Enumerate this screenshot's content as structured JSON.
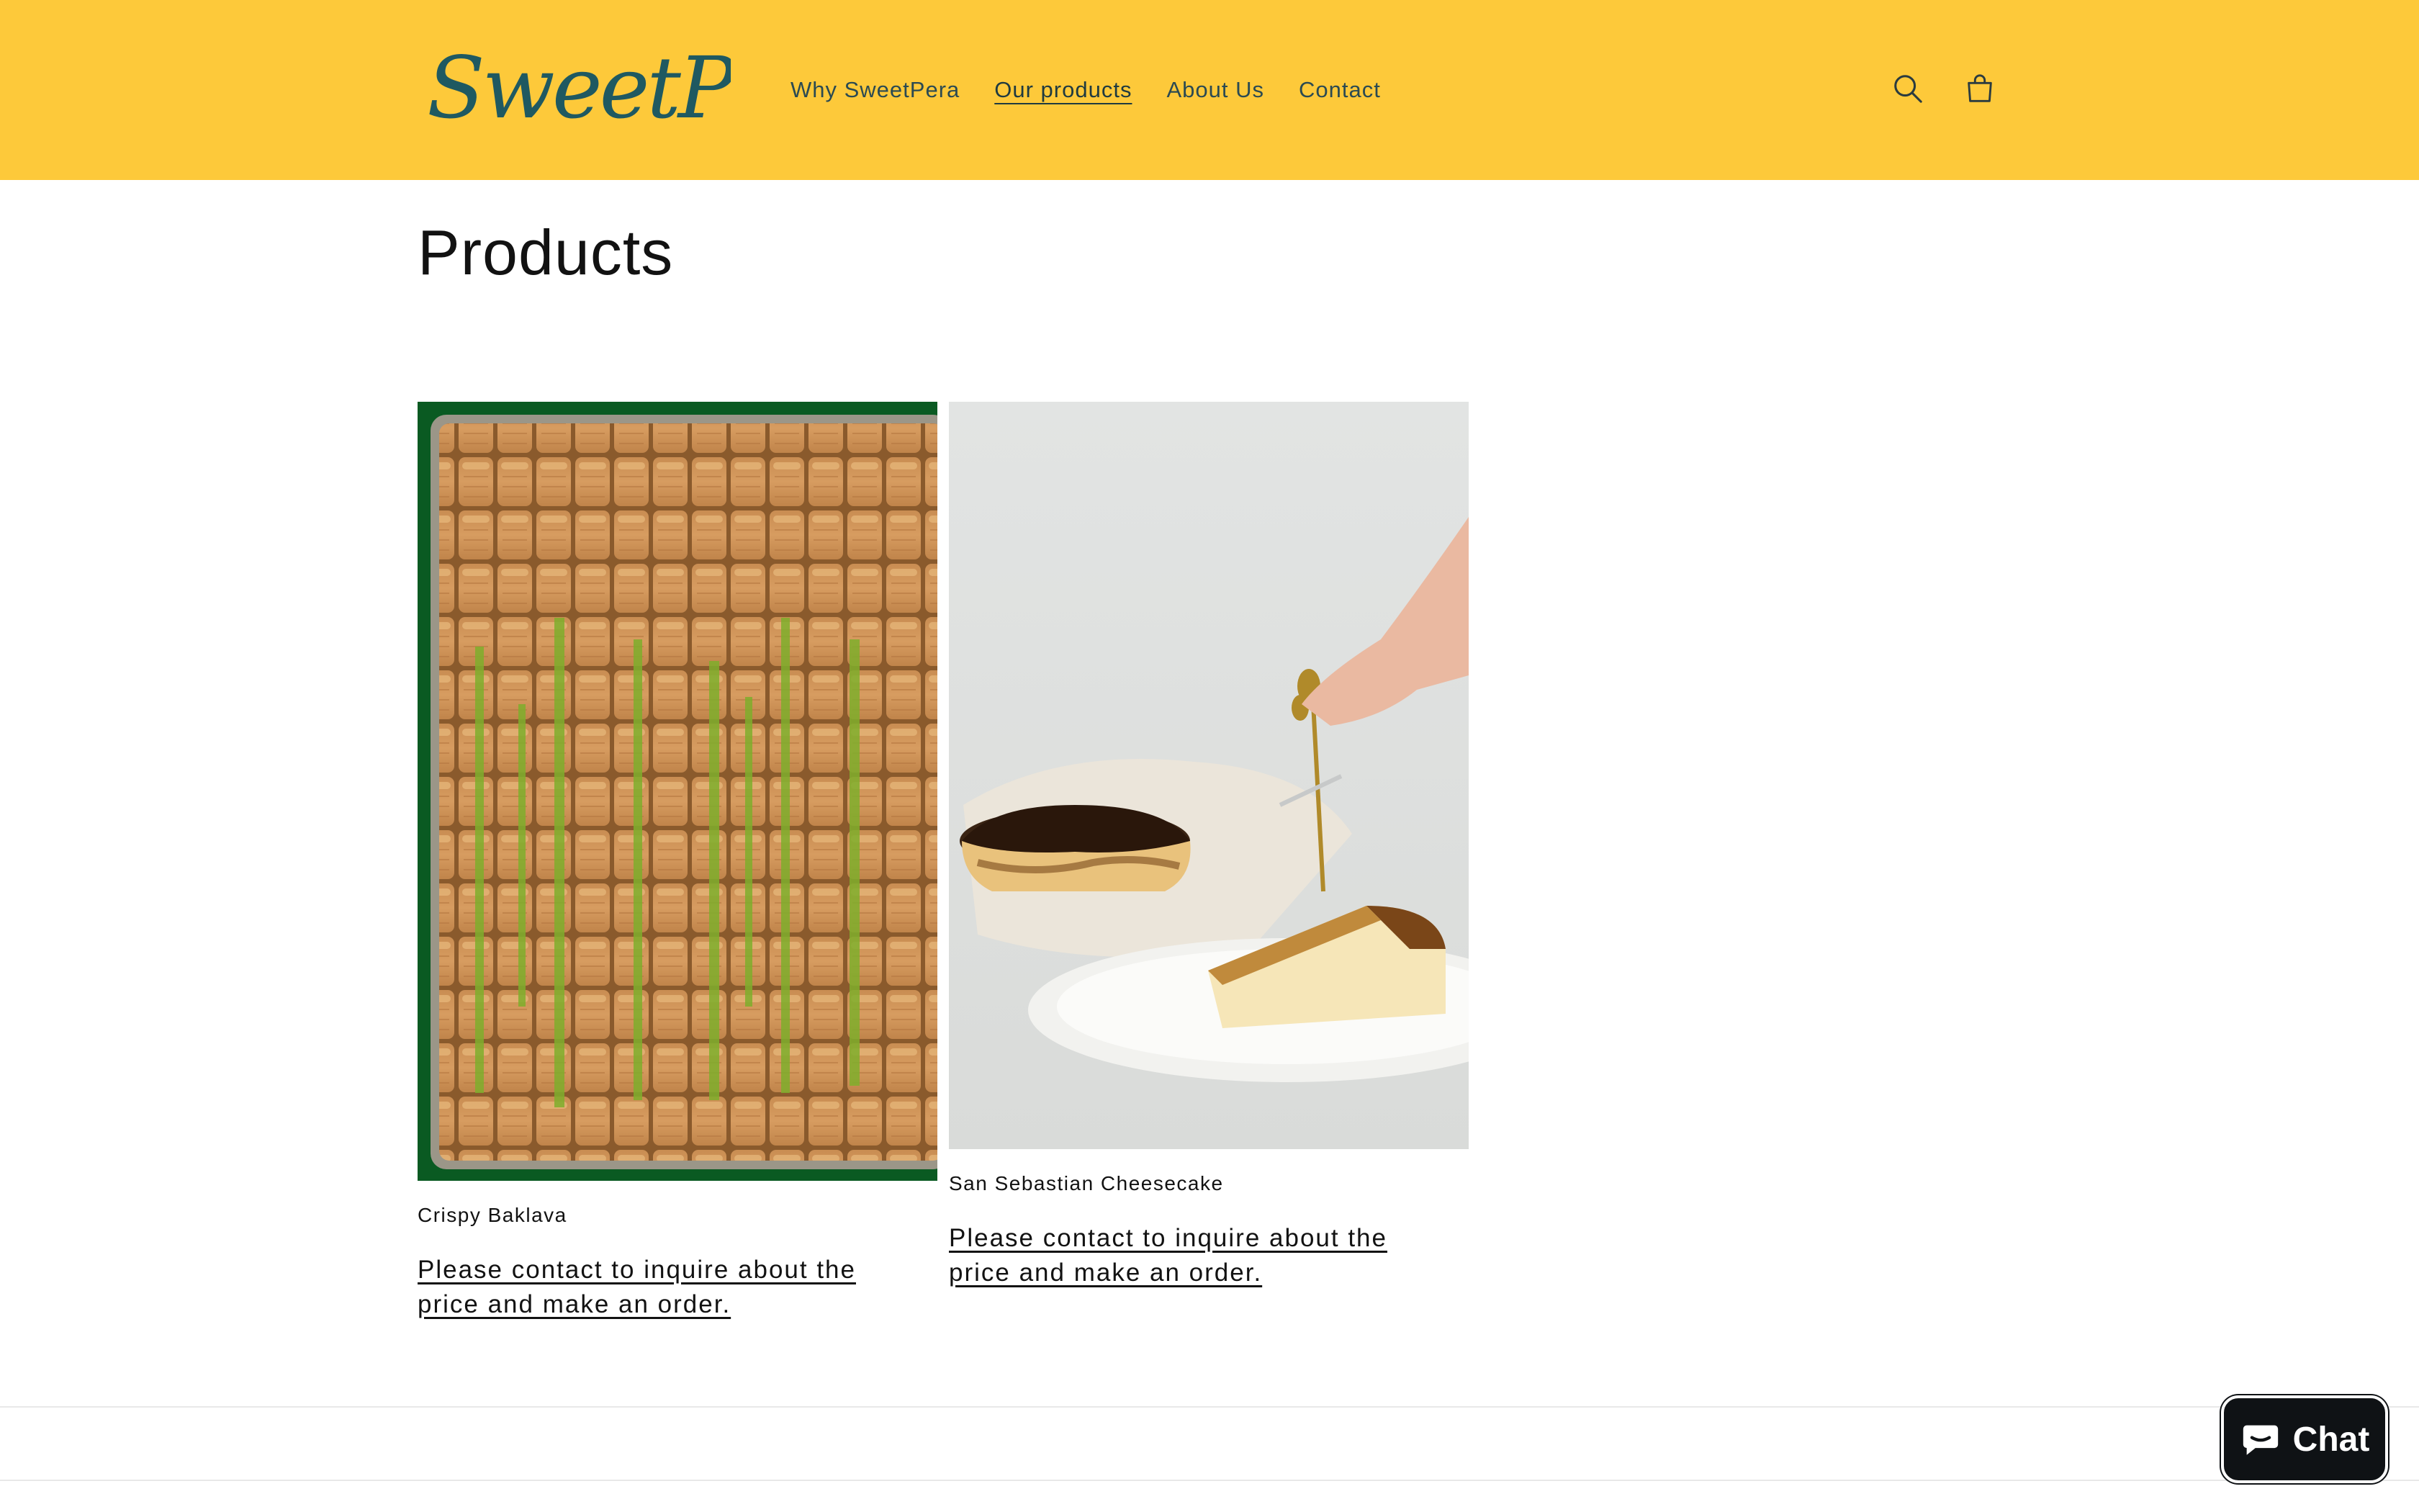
{
  "brand": {
    "logo_text": "SweetPera",
    "logo_color": "#1f5961",
    "header_bg": "#fdc93a"
  },
  "nav": {
    "items": [
      {
        "label": "Why SweetPera"
      },
      {
        "label": "Our products"
      },
      {
        "label": "About Us"
      },
      {
        "label": "Contact"
      }
    ],
    "active_index": 1
  },
  "header_icons": [
    "search-icon",
    "cart-icon"
  ],
  "page": {
    "title": "Products"
  },
  "products": [
    {
      "name": "Crispy Baklava",
      "cta": "Please contact to inquire about the price and make an order."
    },
    {
      "name": "San Sebastian Cheesecake",
      "cta": "Please contact to inquire about the price and make an order."
    }
  ],
  "chat": {
    "label": "Chat",
    "icon": "chat-bubble-icon"
  }
}
